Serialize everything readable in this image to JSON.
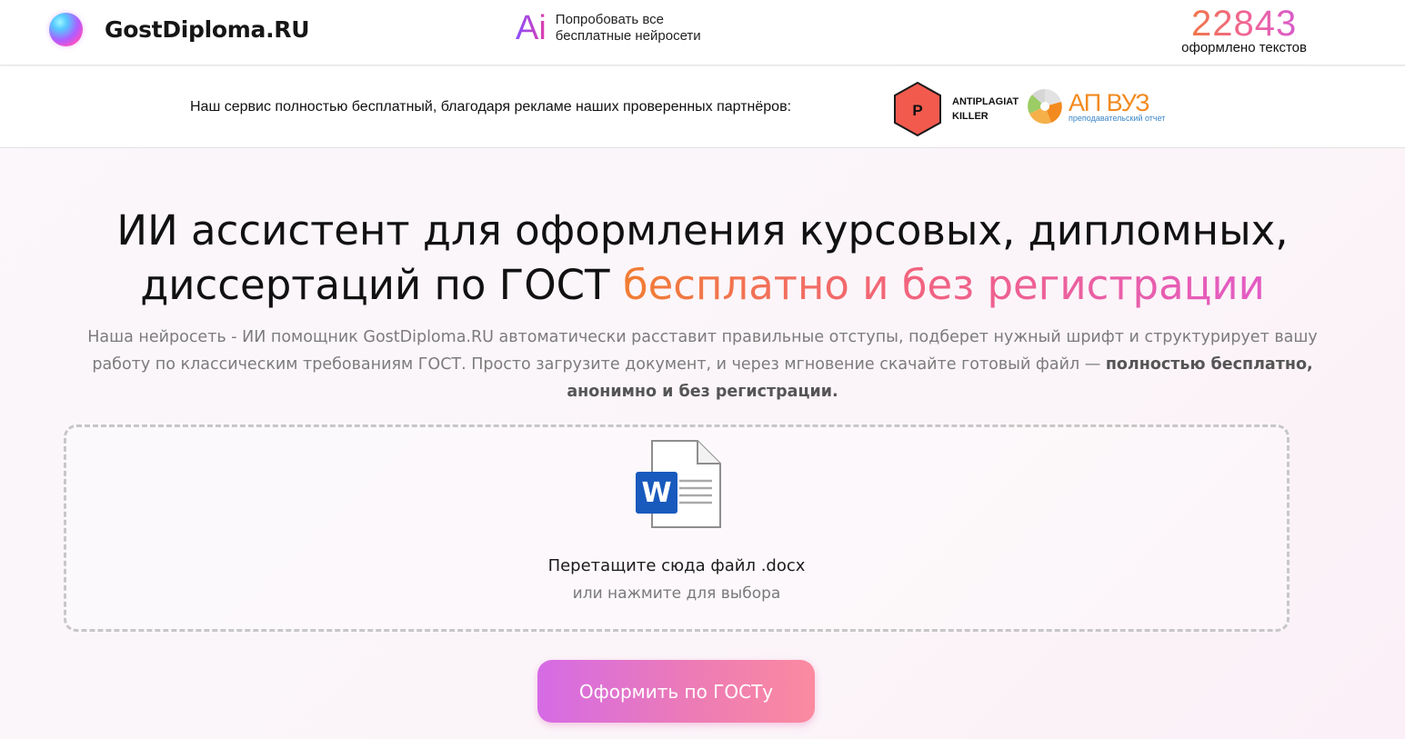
{
  "header": {
    "logo_text": "GostDiploma.RU",
    "ai_mark": "Ai",
    "ai_promo_line1": "Попробовать все",
    "ai_promo_line2": "бесплатные нейросети",
    "counter_value": "22843",
    "counter_label": "оформлено текстов"
  },
  "partners": {
    "text": "Наш сервис полностью бесплатный, благодаря рекламе наших проверенных партнёров:",
    "antiplagiat": {
      "badge_letter": "P",
      "line1": "ANTIPLAGIAT",
      "line2": "KILLER"
    },
    "apvuz": {
      "title": "АП ВУЗ",
      "subtitle": "преподавательский отчет"
    }
  },
  "hero": {
    "title_line1": "ИИ ассистент для оформления курсовых, дипломных,",
    "title_line2_plain": "диссертаций по ГОСТ ",
    "title_line2_highlight": "бесплатно и без регистрации",
    "desc_main": "Наша нейросеть - ИИ помощник GostDiploma.RU автоматически расставит правильные отступы, подберет нужный шрифт и структурирует вашу работу по классическим требованиям ГОСТ. Просто загрузите документ, и через мгновение скачайте готовый файл — ",
    "desc_bold": "полностью бесплатно, анонимно и без регистрации."
  },
  "upload": {
    "icon_letter": "W",
    "main_text": "Перетащите сюда файл .docx",
    "sub_text": "или нажмите для выбора"
  },
  "cta": {
    "label": "Оформить по ГОСТу"
  },
  "colors": {
    "accent_orange": "#f17d32",
    "accent_pink": "#e35bc5",
    "word_blue": "#185abd",
    "antiplagiat_red": "#f25a4e",
    "apvuz_orange": "#f28a1f"
  }
}
